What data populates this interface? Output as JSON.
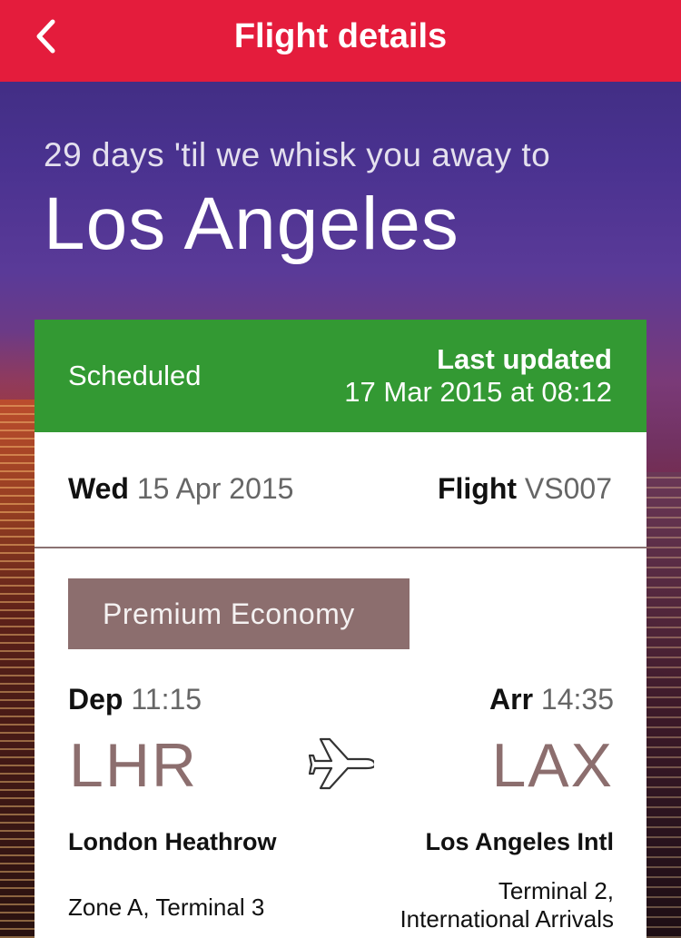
{
  "header": {
    "title": "Flight details",
    "back_icon": "chevron-left-icon",
    "background_color": "#e41c3c"
  },
  "hero": {
    "countdown": "29 days 'til we whisk you away to",
    "destination": "Los Angeles"
  },
  "status": {
    "label": "Scheduled",
    "updated_title": "Last updated",
    "updated_time": "17 Mar 2015 at 08:12",
    "background_color": "#339933"
  },
  "date": {
    "weekday": "Wed",
    "value": "15 Apr 2015"
  },
  "flight": {
    "label": "Flight",
    "number": "VS007"
  },
  "cabin": {
    "label": "Premium Economy",
    "color": "#8c6e6e"
  },
  "departure": {
    "label": "Dep",
    "time": "11:15",
    "code": "LHR",
    "airport": "London Heathrow",
    "terminal": "Zone A, Terminal 3"
  },
  "arrival": {
    "label": "Arr",
    "time": "14:35",
    "code": "LAX",
    "airport": "Los Angeles Intl",
    "terminal_line1": "Terminal 2,",
    "terminal_line2": "International Arrivals"
  },
  "route_icon": "airplane-icon"
}
